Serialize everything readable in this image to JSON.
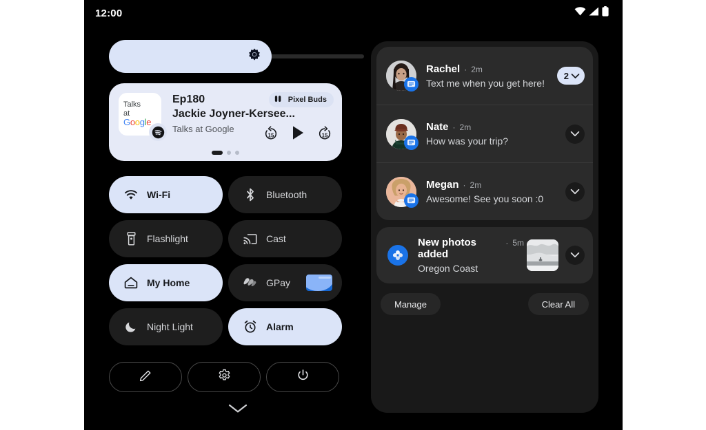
{
  "status_bar": {
    "time": "12:00",
    "icons": [
      "wifi-icon",
      "signal-icon",
      "battery-icon"
    ]
  },
  "brightness": {
    "name": "brightness-slider",
    "icon": "brightness-icon",
    "fill_percent": 64,
    "fill_color": "#dbe4f8",
    "track_color": "#2a2a2a"
  },
  "media_player": {
    "episode": "Ep180",
    "title": "Jackie Joyner-Kersee...",
    "app": "Talks at Google",
    "album_art_line1": "Talks",
    "album_art_line2": "at",
    "album_art_logo": [
      "G",
      "o",
      "o",
      "g",
      "l",
      "e"
    ],
    "app_badge_icon": "spotify-icon",
    "output_device": "Pixel Buds",
    "output_device_icon": "earbuds-icon",
    "controls": [
      {
        "name": "rewind-15-button",
        "icon": "replay-15-icon",
        "label": "15"
      },
      {
        "name": "play-button",
        "icon": "play-icon",
        "label": ""
      },
      {
        "name": "forward-15-button",
        "icon": "forward-15-icon",
        "label": "15"
      }
    ],
    "page_dots": {
      "count": 3,
      "active_index": 0
    },
    "card_color": "#e6eaf7"
  },
  "tiles": [
    {
      "label": "Wi-Fi",
      "icon": "wifi-icon",
      "state": "on",
      "name": "tile-wifi"
    },
    {
      "label": "Bluetooth",
      "icon": "bluetooth-icon",
      "state": "off",
      "name": "tile-bluetooth"
    },
    {
      "label": "Flashlight",
      "icon": "flashlight-icon",
      "state": "off",
      "name": "tile-flashlight"
    },
    {
      "label": "Cast",
      "icon": "cast-icon",
      "state": "off",
      "name": "tile-cast"
    },
    {
      "label": "My Home",
      "icon": "home-icon",
      "state": "on",
      "name": "tile-my-home"
    },
    {
      "label": "GPay",
      "icon": "gpay-icon",
      "state": "off",
      "name": "tile-gpay",
      "has_card": true
    },
    {
      "label": "Night Light",
      "icon": "moon-icon",
      "state": "off",
      "name": "tile-night-light"
    },
    {
      "label": "Alarm",
      "icon": "alarm-icon",
      "state": "on",
      "name": "tile-alarm"
    }
  ],
  "bottom_actions": [
    {
      "name": "edit-tiles-button",
      "icon": "pencil-icon"
    },
    {
      "name": "settings-button",
      "icon": "gear-icon"
    },
    {
      "name": "power-button",
      "icon": "power-icon"
    }
  ],
  "collapse_handle_icon": "chevron-down-icon",
  "notifications": [
    {
      "name": "Rachel",
      "separator": "·",
      "time": "2m",
      "message": "Text me when you get here!",
      "app_badge_icon": "messages-icon",
      "group_count": "2",
      "expand_icon": "chevron-down-icon"
    },
    {
      "name": "Nate",
      "separator": "·",
      "time": "2m",
      "message": "How was your trip?",
      "app_badge_icon": "messages-icon",
      "expand_icon": "chevron-down-icon"
    },
    {
      "name": "Megan",
      "separator": "·",
      "time": "2m",
      "message": "Awesome! See you soon :0",
      "app_badge_icon": "messages-icon",
      "expand_icon": "chevron-down-icon"
    }
  ],
  "photos_notification": {
    "title": "New photos added",
    "separator": "·",
    "time": "5m",
    "subtitle": "Oregon Coast",
    "app_icon": "google-photos-icon",
    "thumbnail": "coast-photo-thumbnail",
    "expand_icon": "chevron-down-icon"
  },
  "notification_actions": {
    "manage": "Manage",
    "clear_all": "Clear All"
  }
}
